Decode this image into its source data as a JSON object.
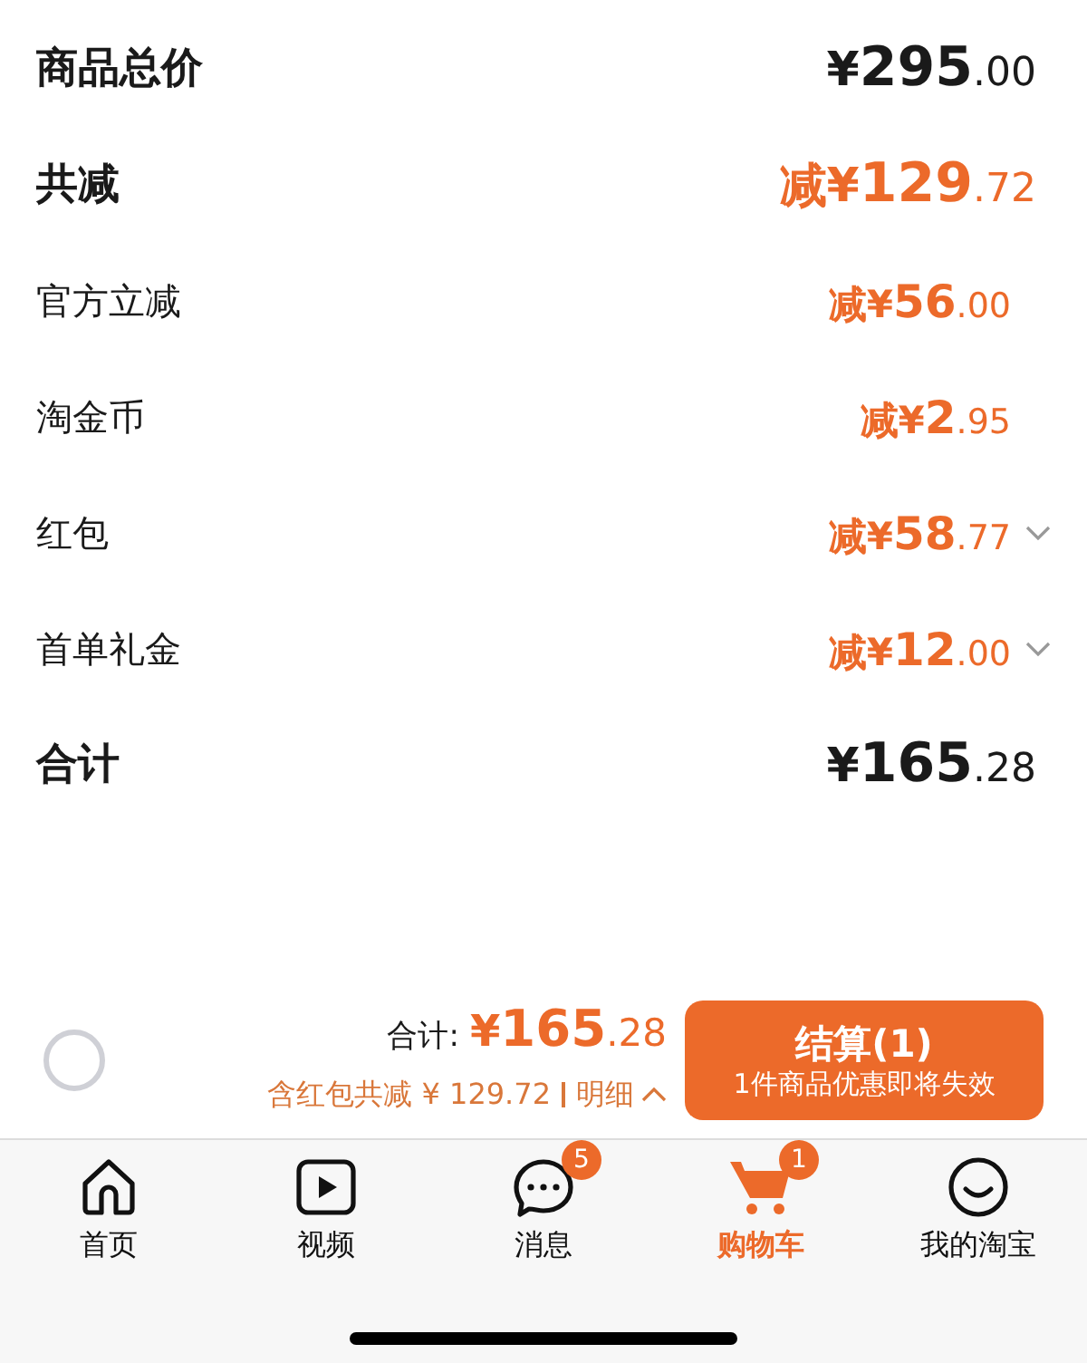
{
  "summary_rows": [
    {
      "kind": "header",
      "label": "商品总价",
      "discount": false,
      "has_detail": false,
      "price": {
        "prefix": "¥",
        "whole": "295",
        "fraction": ".00"
      }
    },
    {
      "kind": "header",
      "label": "共减",
      "discount": true,
      "has_detail": false,
      "price": {
        "prefix": "减¥",
        "whole": "129",
        "fraction": ".72"
      }
    },
    {
      "kind": "item",
      "label": "官方立减",
      "discount": true,
      "has_detail": false,
      "price": {
        "prefix": "减¥",
        "whole": "56",
        "fraction": ".00"
      }
    },
    {
      "kind": "item",
      "label": "淘金币",
      "discount": true,
      "has_detail": false,
      "price": {
        "prefix": "减¥",
        "whole": "2",
        "fraction": ".95"
      }
    },
    {
      "kind": "item",
      "label": "红包",
      "discount": true,
      "has_detail": true,
      "price": {
        "prefix": "减¥",
        "whole": "58",
        "fraction": ".77"
      }
    },
    {
      "kind": "item",
      "label": "首单礼金",
      "discount": true,
      "has_detail": true,
      "price": {
        "prefix": "减¥",
        "whole": "12",
        "fraction": ".00"
      }
    },
    {
      "kind": "header",
      "label": "合计",
      "discount": false,
      "has_detail": false,
      "price": {
        "prefix": "¥",
        "whole": "165",
        "fraction": ".28"
      }
    }
  ],
  "checkout_bar": {
    "select_all": {
      "checked": false
    },
    "total_label": "合计:",
    "total": {
      "prefix": "¥",
      "whole": "165",
      "fraction": ".28"
    },
    "savings": "含红包共减 ¥ 129.72",
    "detail_link": "明细",
    "button": {
      "label": "结算(1)",
      "subtitle": "1件商品优惠即将失效"
    }
  },
  "tab_bar": [
    {
      "label": "首页",
      "selected": false
    },
    {
      "label": "视频",
      "selected": false
    },
    {
      "label": "消息",
      "selected": false,
      "badge": "5"
    },
    {
      "label": "购物车",
      "selected": true,
      "badge": "1"
    },
    {
      "label": "我的淘宝",
      "selected": false
    }
  ]
}
